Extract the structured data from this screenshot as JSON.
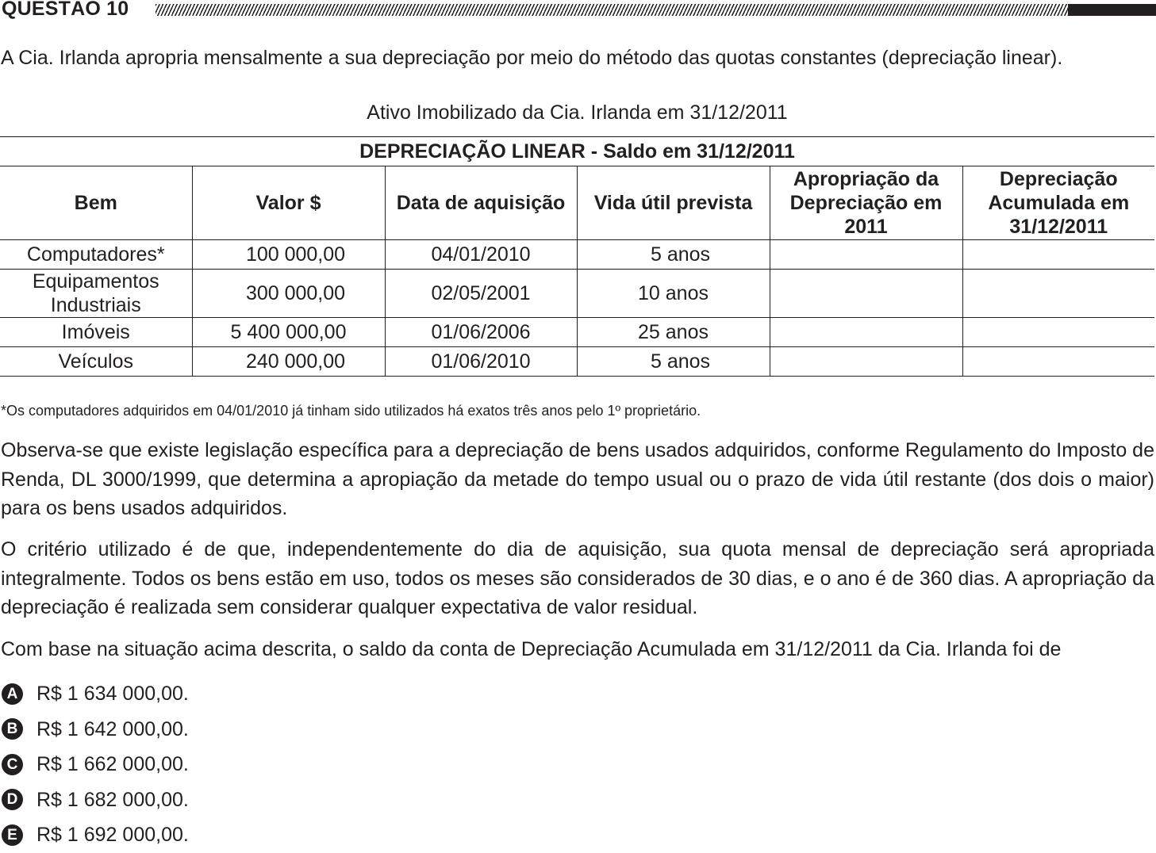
{
  "header": {
    "title": "QUESTÃO 10"
  },
  "intro": "A Cia. Irlanda apropria mensalmente a sua depreciação por meio do método das quotas constantes (depreciação linear).",
  "caption": "Ativo Imobilizado da Cia. Irlanda em 31/12/2011",
  "table": {
    "title": "DEPRECIAÇÃO LINEAR - Saldo em 31/12/2011",
    "columns": [
      "Bem",
      "Valor $",
      "Data de aquisição",
      "Vida útil prevista",
      "Apropriação da Depreciação em 2011",
      "Depreciação Acumulada em 31/12/2011"
    ],
    "rows": [
      {
        "bem": "Computadores*",
        "valor": "100 000,00",
        "data": "04/01/2010",
        "vida": "5 anos",
        "apropriacao": "",
        "acumulada": ""
      },
      {
        "bem": "Equipamentos Industriais",
        "valor": "300 000,00",
        "data": "02/05/2001",
        "vida": "10 anos",
        "apropriacao": "",
        "acumulada": ""
      },
      {
        "bem": "Imóveis",
        "valor": "5 400 000,00",
        "data": "01/06/2006",
        "vida": "25 anos",
        "apropriacao": "",
        "acumulada": ""
      },
      {
        "bem": "Veículos",
        "valor": "240 000,00",
        "data": "01/06/2010",
        "vida": "5 anos",
        "apropriacao": "",
        "acumulada": ""
      }
    ]
  },
  "footnote": "*Os computadores adquiridos em 04/01/2010 já tinham sido utilizados há exatos três anos pelo 1º proprietário.",
  "paragraphs": [
    "Observa-se que existe legislação específica para a depreciação de bens usados adquiridos, conforme Regulamento do Imposto de Renda, DL 3000/1999, que determina a apropiação da metade do tempo usual ou o prazo de vida útil restante (dos dois o maior) para os bens usados adquiridos.",
    "O critério utilizado é de que, independentemente do dia de aquisição, sua quota mensal de depreciação será apropriada integralmente. Todos os bens estão em uso, todos os meses são considerados de 30 dias, e o ano é de 360 dias. A apropriação da depreciação é realizada sem considerar qualquer expectativa de valor residual.",
    "Com base na situação acima descrita, o saldo da conta de Depreciação Acumulada em 31/12/2011 da Cia. Irlanda foi de"
  ],
  "options": [
    {
      "letter": "A",
      "text": "R$ 1 634 000,00."
    },
    {
      "letter": "B",
      "text": "R$ 1 642 000,00."
    },
    {
      "letter": "C",
      "text": "R$ 1 662 000,00."
    },
    {
      "letter": "D",
      "text": "R$ 1 682 000,00."
    },
    {
      "letter": "E",
      "text": "R$ 1 692 000,00."
    }
  ]
}
